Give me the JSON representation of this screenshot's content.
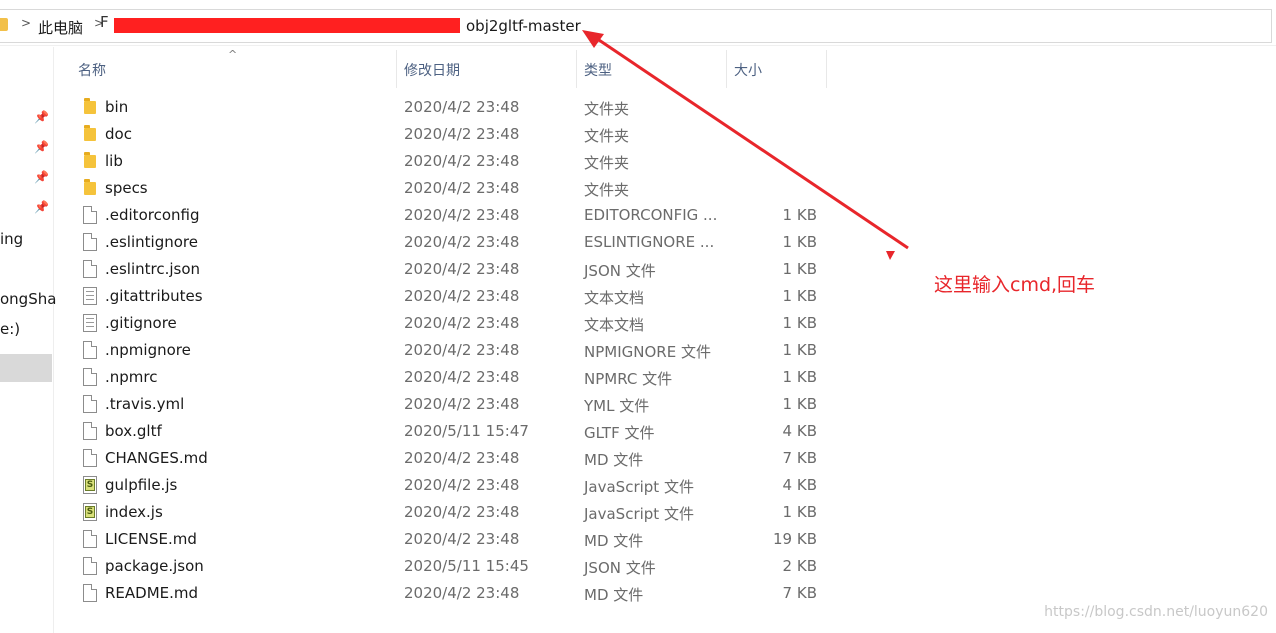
{
  "address": {
    "root_label": "此电脑",
    "folder_label": "obj2gltf-master",
    "hidden_prefix": "F",
    "separators": [
      ">",
      ">"
    ]
  },
  "nav": {
    "pins": [
      "pin-icon",
      "pin-icon",
      "pin-icon",
      "pin-icon"
    ],
    "items": [
      {
        "label": "ing"
      },
      {
        "label": "ongSha"
      },
      {
        "label": "e:)"
      }
    ]
  },
  "columns": {
    "name": "名称",
    "date": "修改日期",
    "type": "类型",
    "size": "大小"
  },
  "files": [
    {
      "name": "bin",
      "date": "2020/4/2 23:48",
      "type": "文件夹",
      "size": "",
      "icon": "folder"
    },
    {
      "name": "doc",
      "date": "2020/4/2 23:48",
      "type": "文件夹",
      "size": "",
      "icon": "folder"
    },
    {
      "name": "lib",
      "date": "2020/4/2 23:48",
      "type": "文件夹",
      "size": "",
      "icon": "folder"
    },
    {
      "name": "specs",
      "date": "2020/4/2 23:48",
      "type": "文件夹",
      "size": "",
      "icon": "folder"
    },
    {
      "name": ".editorconfig",
      "date": "2020/4/2 23:48",
      "type": "EDITORCONFIG ...",
      "size": "1 KB",
      "icon": "file"
    },
    {
      "name": ".eslintignore",
      "date": "2020/4/2 23:48",
      "type": "ESLINTIGNORE ...",
      "size": "1 KB",
      "icon": "file"
    },
    {
      "name": ".eslintrc.json",
      "date": "2020/4/2 23:48",
      "type": "JSON 文件",
      "size": "1 KB",
      "icon": "file"
    },
    {
      "name": ".gitattributes",
      "date": "2020/4/2 23:48",
      "type": "文本文档",
      "size": "1 KB",
      "icon": "text"
    },
    {
      "name": ".gitignore",
      "date": "2020/4/2 23:48",
      "type": "文本文档",
      "size": "1 KB",
      "icon": "text"
    },
    {
      "name": ".npmignore",
      "date": "2020/4/2 23:48",
      "type": "NPMIGNORE 文件",
      "size": "1 KB",
      "icon": "file"
    },
    {
      "name": ".npmrc",
      "date": "2020/4/2 23:48",
      "type": "NPMRC 文件",
      "size": "1 KB",
      "icon": "file"
    },
    {
      "name": ".travis.yml",
      "date": "2020/4/2 23:48",
      "type": "YML 文件",
      "size": "1 KB",
      "icon": "file"
    },
    {
      "name": "box.gltf",
      "date": "2020/5/11 15:47",
      "type": "GLTF 文件",
      "size": "4 KB",
      "icon": "file"
    },
    {
      "name": "CHANGES.md",
      "date": "2020/4/2 23:48",
      "type": "MD 文件",
      "size": "7 KB",
      "icon": "file"
    },
    {
      "name": "gulpfile.js",
      "date": "2020/4/2 23:48",
      "type": "JavaScript 文件",
      "size": "4 KB",
      "icon": "js"
    },
    {
      "name": "index.js",
      "date": "2020/4/2 23:48",
      "type": "JavaScript 文件",
      "size": "1 KB",
      "icon": "js"
    },
    {
      "name": "LICENSE.md",
      "date": "2020/4/2 23:48",
      "type": "MD 文件",
      "size": "19 KB",
      "icon": "file"
    },
    {
      "name": "package.json",
      "date": "2020/5/11 15:45",
      "type": "JSON 文件",
      "size": "2 KB",
      "icon": "file"
    },
    {
      "name": "README.md",
      "date": "2020/4/2 23:48",
      "type": "MD 文件",
      "size": "7 KB",
      "icon": "file"
    }
  ],
  "annotation": {
    "text": "这里输入cmd,回车",
    "color": "#e8262b"
  },
  "watermark": "https://blog.csdn.net/luoyun620",
  "colors": {
    "folder": "#f5c33b",
    "header_text": "#4d6182",
    "selection": "#d9d9d9"
  }
}
